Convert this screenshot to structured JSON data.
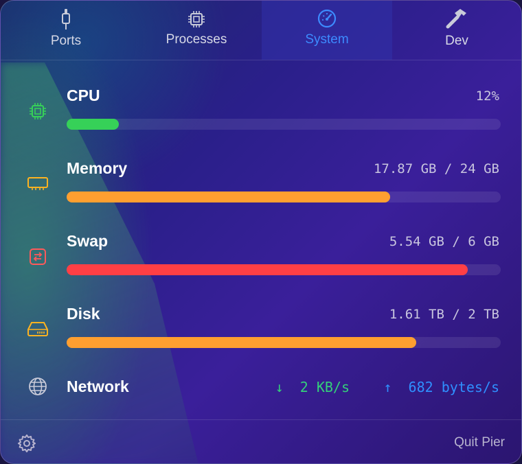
{
  "tabs": [
    {
      "label": "Ports",
      "icon": "plug-icon"
    },
    {
      "label": "Processes",
      "icon": "chip-icon"
    },
    {
      "label": "System",
      "icon": "gauge-icon",
      "active": true
    },
    {
      "label": "Dev",
      "icon": "hammer-icon"
    }
  ],
  "metrics": {
    "cpu": {
      "label": "CPU",
      "value": "12%",
      "fraction": 0.12,
      "color": "#36d158",
      "icon": "cpu-icon"
    },
    "memory": {
      "label": "Memory",
      "value": "17.87 GB / 24 GB",
      "fraction": 0.7446,
      "color": "#ff9f30",
      "icon": "memory-icon"
    },
    "swap": {
      "label": "Swap",
      "value": "5.54 GB / 6 GB",
      "fraction": 0.9233,
      "color": "#ff3f45",
      "icon": "swap-icon"
    },
    "disk": {
      "label": "Disk",
      "value": "1.61 TB / 2 TB",
      "fraction": 0.805,
      "color": "#ff9f30",
      "icon": "disk-icon"
    }
  },
  "network": {
    "label": "Network",
    "down": "2 KB/s",
    "up": "682 bytes/s",
    "icon": "globe-icon",
    "down_color": "#34d07a",
    "up_color": "#2f8fff"
  },
  "footer": {
    "settings_icon": "gear-icon",
    "quit_label": "Quit Pier"
  }
}
